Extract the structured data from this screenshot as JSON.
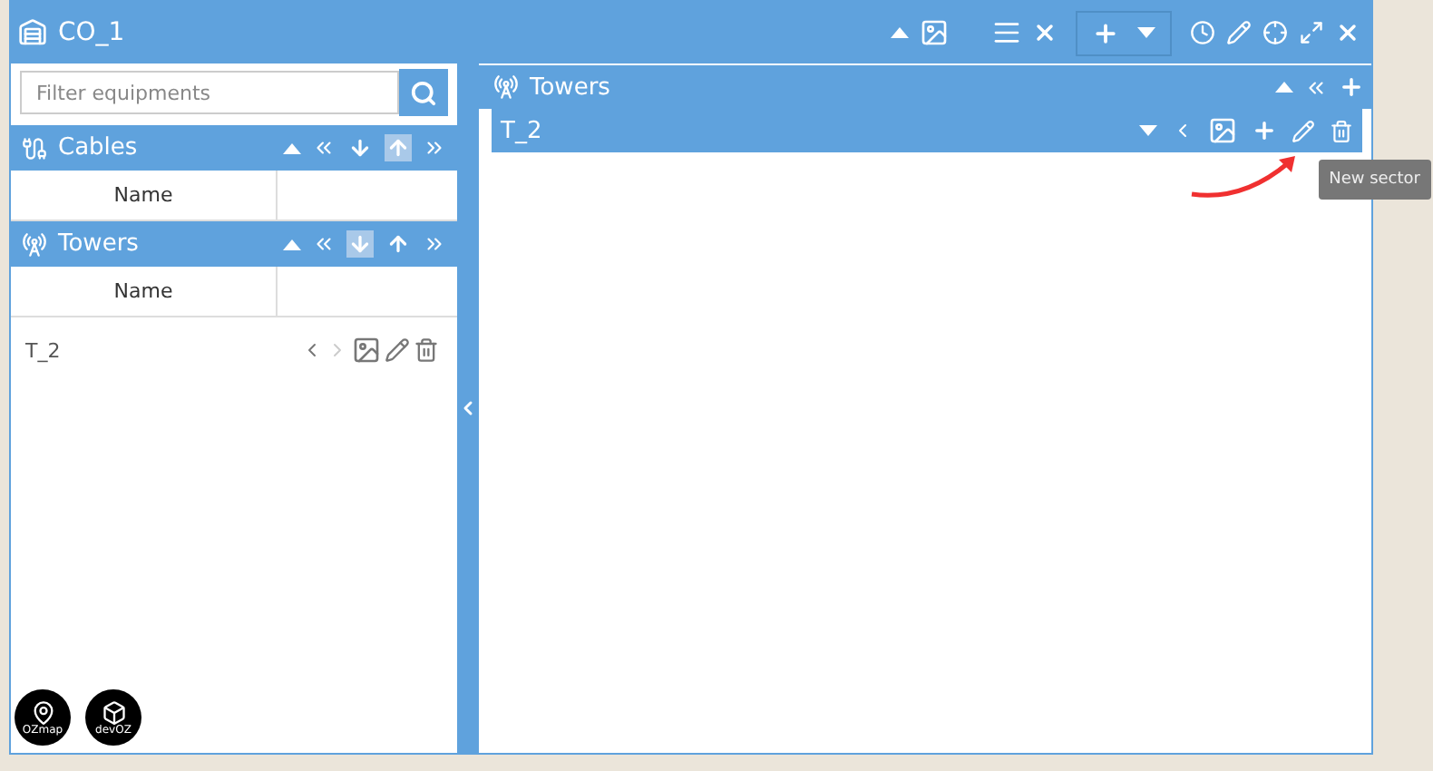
{
  "window": {
    "title": "CO_1"
  },
  "search": {
    "placeholder": "Filter equipments"
  },
  "sections": [
    {
      "title": "Cables",
      "kind": "cables",
      "up_disabled": true,
      "down_disabled": false,
      "columns": [
        "Name"
      ]
    },
    {
      "title": "Towers",
      "kind": "towers",
      "up_disabled": false,
      "down_disabled": true,
      "columns": [
        "Name"
      ],
      "rows": [
        {
          "name": "T_2",
          "next_disabled": true
        }
      ]
    }
  ],
  "detail": {
    "title": "Towers",
    "items": [
      {
        "name": "T_2",
        "tooltip": "New sector"
      }
    ]
  },
  "logos": [
    "OZmap",
    "devOZ"
  ]
}
